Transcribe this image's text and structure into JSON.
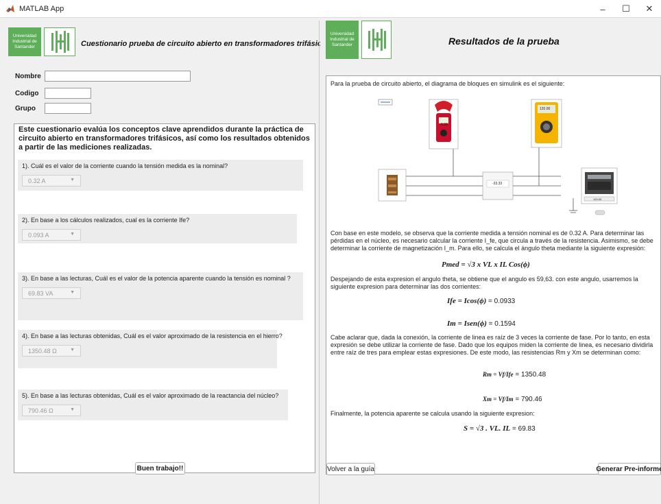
{
  "window": {
    "title": "MATLAB App",
    "minimize": "–",
    "maximize": "☐",
    "close": "✕"
  },
  "left": {
    "logo_text": "Universidad\nIndustrial de\nSantander",
    "title": "Cuestionario prueba de circuito abierto en transformadores trifásicos",
    "fields": {
      "name_label": "Nombre",
      "code_label": "Codigo",
      "group_label": "Grupo"
    },
    "intro": "Este cuestionario evalúa los conceptos clave aprendidos durante la práctica de circuito abierto en transformadores trifásicos, así como los resultados obtenidos a partir de las mediciones realizadas.",
    "questions": [
      {
        "text": "1). Cuál es el valor de la corriente cuando la tensión medida es la nominal?",
        "answer": "0.32 A"
      },
      {
        "text": "2). En base a los cálculos realizados, cual es la corriente Ife?",
        "answer": "0.093 A"
      },
      {
        "text": "3). En base a las lecturas, Cuál es el valor de la potencia aparente cuando la tensión es nominal ?",
        "answer": "69.83 VA"
      },
      {
        "text": "4). En base a las lecturas obtenidas, Cuál es el valor aproximado de la resistencia en el hierro?",
        "answer": "1350.48 Ω"
      },
      {
        "text": "5). En base a las lecturas obtenidas, Cuál es el valor aproximado de la reactancia del núcleo?",
        "answer": "790.46 Ω"
      }
    ],
    "finish_button": "Buen trabajo!!"
  },
  "right": {
    "logo_text": "Universidad\nIndustrial de\nSantander",
    "title": "Resultados de la prueba",
    "p1": "Para la prueba de circuito abierto, el diagrama de bloques en simulink es el siguiente:",
    "diagram": {
      "clamp_reading": "0.32",
      "meter_reading": "120.00",
      "block_reading": "-33.33",
      "source_reading": "120.00"
    },
    "p2": "Con base en este modelo, se observa que la corriente medida a tensión nominal es de 0.32 A. Para determinar las pérdidas en el núcleo, es necesario calcular la corriente I_fe, que circula a través de la resistencia. Asimismo, se debe determinar la corriente de magnetización I_m. Para ello, se calcula el ángulo theta mediante la siguiente expresión:",
    "f_pmed": "Pmed = √3 x VL x IL Cos(ϕ)",
    "p3": "Despejando de esta expresion el angulo theta, se obtiene que el angulo es 59,63. con este angulo, usarremos la siguiente expresion para determinar las dos corrientes:",
    "f_ife": "Ife = Icos(ϕ)",
    "f_ife_val": " = 0.0933",
    "f_im": "Im = Isen(ϕ)",
    "f_im_val": " = 0.1594",
    "p4": "Cabe aclarar que, dada la conexión, la corriente de linea es raíz de 3 veces la corriente de fase. Por lo tanto, en esta expresión se debe utilizar la corriente de fase. Dado que los equipos miden la corriente de linea, es necesario dividirla entre raíz de tres para emplear estas expresiones. De este modo, las resistencias Rm y Xm se determinan como:",
    "f_rm": "Rm = Vf/Ife",
    "f_rm_val": " = 1350.48",
    "f_xm": "Xm = Vf/Im",
    "f_xm_val": " = 790.46",
    "p5": "Finalmente, la potencia aparente se calcula usando la siguiente expresion:",
    "f_s": "S = √3 . VL. IL",
    "f_s_val": " = 69.83",
    "back_button": "Volver a la guía",
    "report_button": "Generar Pre-informe"
  }
}
